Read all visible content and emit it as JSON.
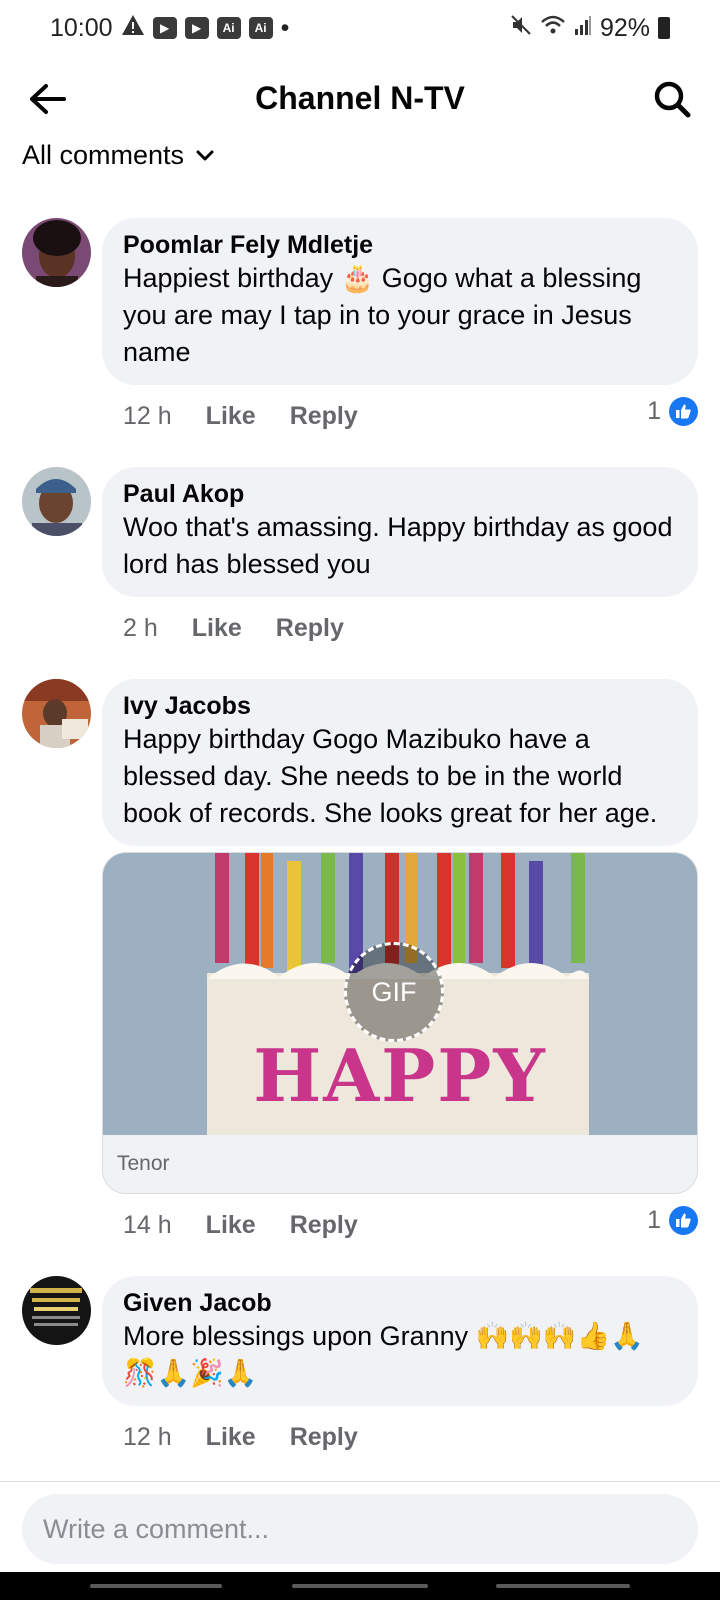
{
  "status_bar": {
    "time": "10:00",
    "notification_icons": [
      "warning-icon",
      "youtube-icon",
      "youtube-icon",
      "ai-icon",
      "ai-icon"
    ],
    "ai_label": "Ai",
    "dot": "•",
    "battery": "92%"
  },
  "header": {
    "title": "Channel N-TV"
  },
  "filter": {
    "label": "All comments"
  },
  "comments": [
    {
      "author": "Poomlar Fely Mdletje",
      "text": "Happiest birthday 🎂 Gogo what a blessing you are may I tap in to your grace in Jesus name",
      "time": "12 h",
      "like_label": "Like",
      "reply_label": "Reply",
      "reaction_count": "1"
    },
    {
      "author": "Paul Akop",
      "text": "Woo that's amassing. Happy birthday as good lord has blessed you",
      "time": "2 h",
      "like_label": "Like",
      "reply_label": "Reply"
    },
    {
      "author": "Ivy Jacobs",
      "text": "Happy birthday Gogo Mazibuko have a blessed day. She needs to be in the world book of records. She looks great for her age.",
      "time": "14 h",
      "like_label": "Like",
      "reply_label": "Reply",
      "reaction_count": "1",
      "gif": {
        "badge": "GIF",
        "caption": "HAPPY",
        "source": "Tenor"
      }
    },
    {
      "author": "Given Jacob",
      "text": "More blessings upon Granny 🙌🙌🙌👍🙏🎊🙏🎉🙏",
      "time": "12 h",
      "like_label": "Like",
      "reply_label": "Reply"
    }
  ],
  "composer": {
    "placeholder": "Write a comment..."
  },
  "colors": {
    "like_blue": "#1877f2",
    "bubble_bg": "#f0f2f5",
    "meta_gray": "#65676b"
  }
}
